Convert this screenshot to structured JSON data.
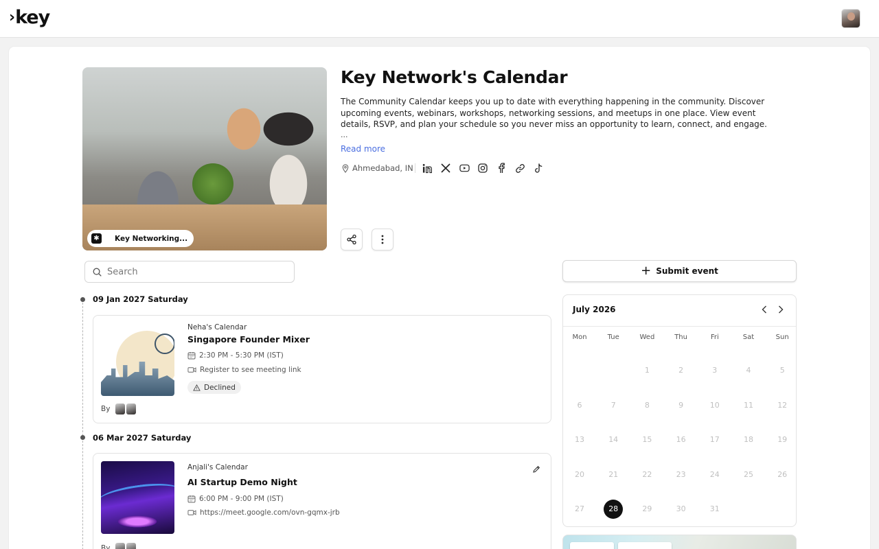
{
  "header": {
    "logo_mark": "›",
    "logo_text": "key"
  },
  "profile": {
    "title": "Key Network's Calendar",
    "description": "The Community Calendar keeps you up to date with everything happening in the community. Discover upcoming events, webinars, workshops, networking sessions, and meetups in one place. View event details, RSVP, and plan your schedule so you never miss an opportunity to learn, connect, and engage.",
    "ellipsis": "...",
    "read_more": "Read more",
    "location": "Ahmedabad, IN",
    "image_tag": "Key Networking...",
    "socials": [
      "linkedin-icon",
      "x-icon",
      "youtube-icon",
      "instagram-icon",
      "facebook-icon",
      "link-icon",
      "tiktok-icon"
    ]
  },
  "search": {
    "placeholder": "Search",
    "value": ""
  },
  "timeline": [
    {
      "date": "09 Jan 2027 Saturday",
      "event": {
        "calendar": "Neha's Calendar",
        "title": "Singapore Founder Mixer",
        "time": "2:30 PM - 5:30 PM (IST)",
        "meeting": "Register to see meeting link",
        "status": "Declined",
        "by_label": "By"
      }
    },
    {
      "date": "06 Mar 2027 Saturday",
      "event": {
        "calendar": "Anjali's Calendar",
        "title": "AI Startup Demo Night",
        "time": "6:00 PM - 9:00 PM (IST)",
        "meeting": "https://meet.google.com/ovn-gqmx-jrb",
        "by_label": "By"
      }
    }
  ],
  "sidebar": {
    "submit_label": "Submit event",
    "calendar": {
      "month": "July 2026",
      "weekdays": [
        "Mon",
        "Tue",
        "Wed",
        "Thu",
        "Fri",
        "Sat",
        "Sun"
      ],
      "first_weekday_index": 2,
      "days_in_month": 31,
      "selected_day": 28
    }
  },
  "colors": {
    "accent_link": "#4a6ee0",
    "selected_day": "#111111"
  }
}
